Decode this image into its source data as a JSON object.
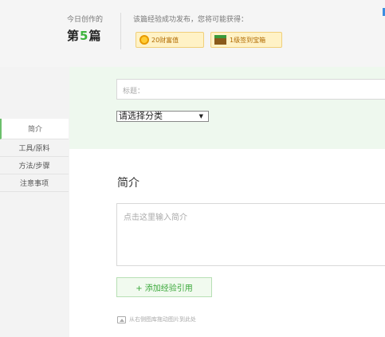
{
  "header": {
    "today_label": "今日创作的",
    "count_prefix": "第",
    "count_number": "5",
    "count_suffix": "篇",
    "reward_hint": "该篇经验成功发布，您将可能获得：",
    "badges": [
      {
        "label": "20财富值",
        "icon": "coin-icon"
      },
      {
        "label": "1级签到宝箱",
        "icon": "treasure-chest-icon"
      }
    ]
  },
  "form": {
    "title_placeholder": "标题：",
    "category_value": "请选择分类",
    "category_arrow": "▼"
  },
  "nav": {
    "items": [
      {
        "label": "简介",
        "active": true
      },
      {
        "label": "工具/原料",
        "active": false
      },
      {
        "label": "方法/步骤",
        "active": false
      },
      {
        "label": "注意事项",
        "active": false
      }
    ]
  },
  "intro": {
    "section_title": "简介",
    "placeholder": "点击这里输入简介",
    "add_ref_label": "+ 添加经验引用",
    "drag_hint": "从右侧图库拖动图片到此处"
  },
  "colors": {
    "accent_green": "#3bb33b",
    "green_area": "#eef8ee",
    "badge_bg": "#fff2c6",
    "link_blue": "#3b8de0"
  }
}
